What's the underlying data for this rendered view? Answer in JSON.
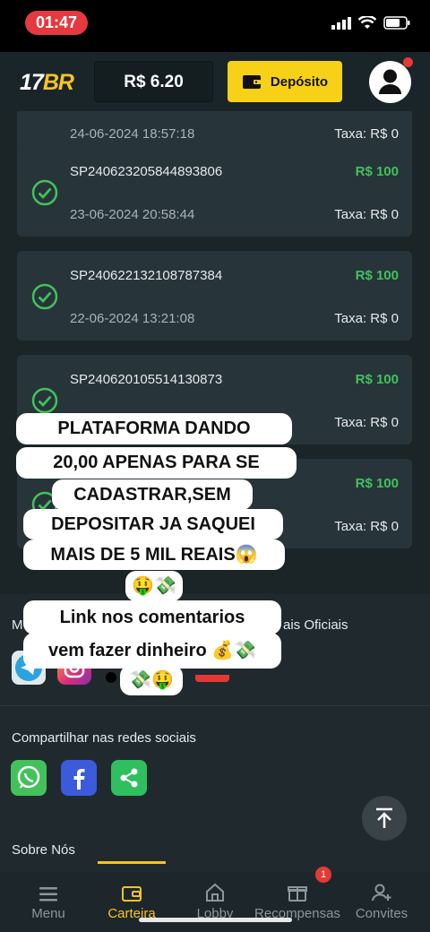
{
  "status_bar": {
    "time": "01:47"
  },
  "header": {
    "logo_num": "17",
    "logo_text": "BR",
    "balance": "R$ 6.20",
    "deposit_label": "Depósito"
  },
  "transactions": [
    {
      "id": "",
      "date": "24-06-2024 18:57:18",
      "amount": "",
      "fee": "Taxa: R$ 0"
    },
    {
      "id": "SP240623205844893806",
      "date": "23-06-2024 20:58:44",
      "amount": "R$ 100",
      "fee": "Taxa: R$ 0"
    },
    {
      "id": "SP240622132108787384",
      "date": "22-06-2024 13:21:08",
      "amount": "R$ 100",
      "fee": "Taxa: R$ 0"
    },
    {
      "id": "SP240620105514130873",
      "date": "",
      "amount": "R$ 100",
      "fee": "Taxa: R$ 0"
    },
    {
      "id": "",
      "date": "",
      "amount": "R$ 100",
      "fee": "Taxa: R$ 0"
    }
  ],
  "footer": {
    "social_left": "M",
    "social_right": "ais Oficiais",
    "share_label": "Compartilhar nas redes sociais",
    "about_label": "Sobre Nós"
  },
  "overlay": {
    "line1": "PLATAFORMA DANDO",
    "line2": "20,00 APENAS PARA SE",
    "line3": "CADASTRAR,SEM",
    "line4": "DEPOSITAR JA SAQUEI",
    "line5": "MAIS DE 5 MIL REAIS😱",
    "line6": "🤑💸",
    "line7": "Link nos comentarios",
    "line8": "vem fazer dinheiro 💰💸",
    "line9": "💸🤑"
  },
  "bottom_nav": {
    "items": [
      {
        "label": "Menu"
      },
      {
        "label": "Carteira"
      },
      {
        "label": "Lobby"
      },
      {
        "label": "Recompensas"
      },
      {
        "label": "Convites"
      }
    ],
    "badge": "1"
  },
  "colors": {
    "accent": "#f7c325",
    "success": "#43c15b",
    "background": "#1b2528"
  }
}
